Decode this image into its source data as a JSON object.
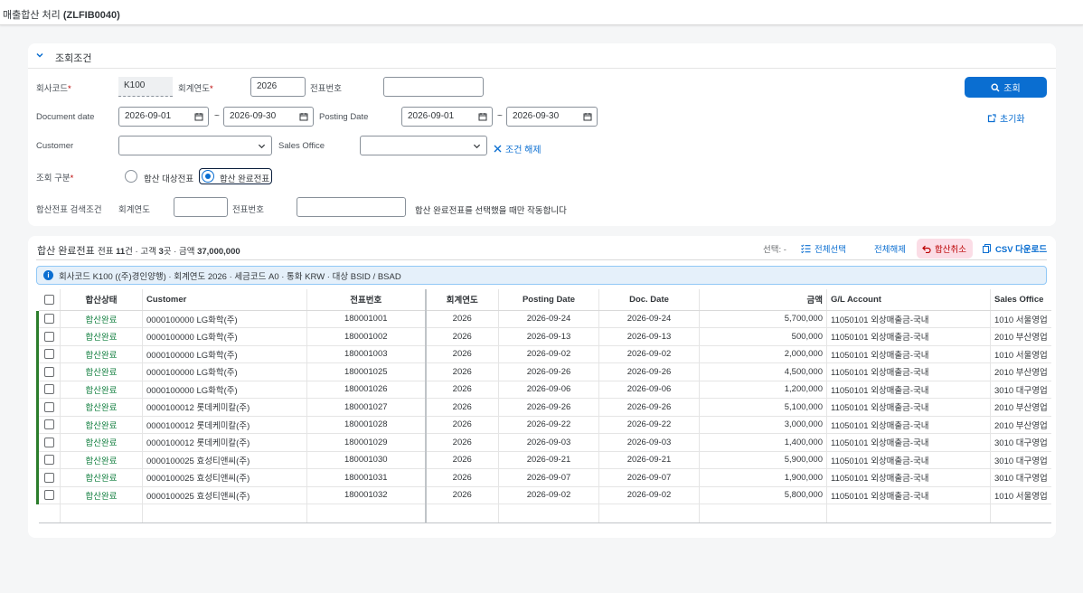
{
  "app": {
    "title": "매출합산 처리",
    "code": "(ZLFIB0040)"
  },
  "filter": {
    "panel_title": "조회조건",
    "company_code_label": "회사코드",
    "company_code_value": "K100",
    "fiscal_year_label": "회계연도",
    "fiscal_year_value": "2026",
    "doc_no_label": "전표번호",
    "doc_no_value": "",
    "document_date_label": "Document date",
    "document_date_from": "2026-09-01",
    "document_date_to": "2026-09-30",
    "posting_date_label": "Posting Date",
    "posting_date_from": "2026-09-01",
    "posting_date_to": "2026-09-30",
    "range_sep": "~",
    "customer_label": "Customer",
    "customer_value": "",
    "sales_office_label": "Sales Office",
    "sales_office_value": "",
    "clear_conditions": "조건 해제",
    "query_type_label": "조회 구분",
    "radio_target": "합산 대상전표",
    "radio_done": "합산 완료전표",
    "sum_search_label": "합산전표 검색조건",
    "sum_fiscal_year_label": "회계연도",
    "sum_fiscal_year_value": "",
    "sum_doc_no_label": "전표번호",
    "sum_doc_no_value": "",
    "sum_hint": "합산 완료전표를 선택했을 때만 작동합니다",
    "search_button": "조회",
    "reset_button": "초기화"
  },
  "results": {
    "title": "합산 완료전표",
    "summary_pre1": "전표 ",
    "doc_count": "11",
    "summary_pre2": "건 · 고객 ",
    "customer_count": "3",
    "summary_pre3": "곳 · 금액 ",
    "total_amount": "37,000,000",
    "selection": "선택: -",
    "select_all": "전체선택",
    "deselect_all": "전체해제",
    "cancel_sum": "합산취소",
    "csv_download": "CSV 다운로드",
    "info": "회사코드 K100 ((주)경인양행) · 회계연도 2026 · 세금코드 A0 · 통화 KRW · 대상 BSID / BSAD",
    "columns": [
      "합산상태",
      "Customer",
      "전표번호",
      "회계연도",
      "Posting Date",
      "Doc. Date",
      "금액",
      "G/L Account",
      "Sales Office"
    ],
    "rows": [
      [
        "합산완료",
        "0000100000 LG화학(주)",
        "180001001",
        "2026",
        "2026-09-24",
        "2026-09-24",
        "5,700,000",
        "11050101 외상매출금-국내",
        "1010 서울영업"
      ],
      [
        "합산완료",
        "0000100000 LG화학(주)",
        "180001002",
        "2026",
        "2026-09-13",
        "2026-09-13",
        "500,000",
        "11050101 외상매출금-국내",
        "2010 부산영업"
      ],
      [
        "합산완료",
        "0000100000 LG화학(주)",
        "180001003",
        "2026",
        "2026-09-02",
        "2026-09-02",
        "2,000,000",
        "11050101 외상매출금-국내",
        "1010 서울영업"
      ],
      [
        "합산완료",
        "0000100000 LG화학(주)",
        "180001025",
        "2026",
        "2026-09-26",
        "2026-09-26",
        "4,500,000",
        "11050101 외상매출금-국내",
        "2010 부산영업"
      ],
      [
        "합산완료",
        "0000100000 LG화학(주)",
        "180001026",
        "2026",
        "2026-09-06",
        "2026-09-06",
        "1,200,000",
        "11050101 외상매출금-국내",
        "3010 대구영업"
      ],
      [
        "합산완료",
        "0000100012 롯데케미칼(주)",
        "180001027",
        "2026",
        "2026-09-26",
        "2026-09-26",
        "5,100,000",
        "11050101 외상매출금-국내",
        "2010 부산영업"
      ],
      [
        "합산완료",
        "0000100012 롯데케미칼(주)",
        "180001028",
        "2026",
        "2026-09-22",
        "2026-09-22",
        "3,000,000",
        "11050101 외상매출금-국내",
        "2010 부산영업"
      ],
      [
        "합산완료",
        "0000100012 롯데케미칼(주)",
        "180001029",
        "2026",
        "2026-09-03",
        "2026-09-03",
        "1,400,000",
        "11050101 외상매출금-국내",
        "3010 대구영업"
      ],
      [
        "합산완료",
        "0000100025 효성티앤씨(주)",
        "180001030",
        "2026",
        "2026-09-21",
        "2026-09-21",
        "5,900,000",
        "11050101 외상매출금-국내",
        "3010 대구영업"
      ],
      [
        "합산완료",
        "0000100025 효성티앤씨(주)",
        "180001031",
        "2026",
        "2026-09-07",
        "2026-09-07",
        "1,900,000",
        "11050101 외상매출금-국내",
        "3010 대구영업"
      ],
      [
        "합산완료",
        "0000100025 효성티앤씨(주)",
        "180001032",
        "2026",
        "2026-09-02",
        "2026-09-02",
        "5,800,000",
        "11050101 외상매출금-국내",
        "1010 서울영업"
      ]
    ]
  },
  "colors": {
    "accent": "#0a6ed1",
    "success": "#107e3e",
    "danger": "#bb0000",
    "danger_bg": "#fbdde6",
    "info_bg": "#e5f0fa"
  },
  "icons": [
    "chevron-down-icon",
    "calendar-icon",
    "dropdown-icon",
    "close-icon",
    "search-icon",
    "reset-icon",
    "checklist-icon",
    "undo-icon",
    "csv-icon",
    "info-icon"
  ]
}
